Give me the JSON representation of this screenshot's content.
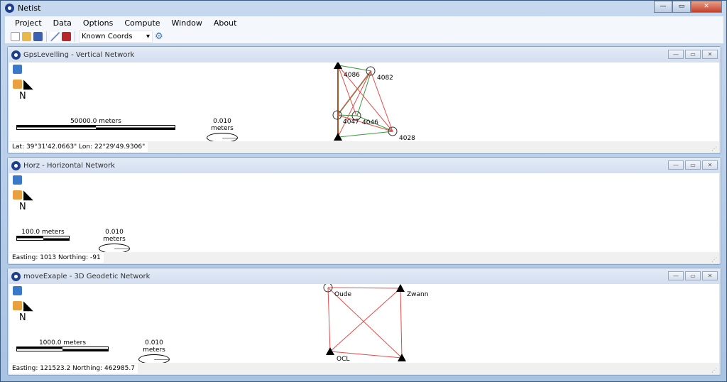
{
  "app": {
    "title": "Netist",
    "controls": [
      "minimize",
      "maximize",
      "close"
    ]
  },
  "menu": [
    "Project",
    "Data",
    "Options",
    "Compute",
    "Window",
    "About"
  ],
  "toolbar": {
    "icons": [
      "new-file-icon",
      "open-folder-icon",
      "save-icon",
      "draw-icon",
      "toolbox-icon"
    ],
    "combo_value": "Known Coords",
    "settings_icon": "gear-icon"
  },
  "windows": [
    {
      "title": "GpsLevelling - Vertical Network",
      "scale_label": "50000.0 meters",
      "ellipse_label": "0.010 meters",
      "status": "Lat: 39°31'42.0663\"  Lon: 22°29'49.9306\"",
      "stations": [
        {
          "name": "4086",
          "type": "fixed"
        },
        {
          "name": "4082",
          "type": "free"
        },
        {
          "name": "4047",
          "type": "free"
        },
        {
          "name": "4046",
          "type": "free"
        },
        {
          "name": "4028",
          "type": "free"
        },
        {
          "name": "",
          "type": "fixed"
        }
      ]
    },
    {
      "title": "Horz - Horizontal Network",
      "scale_label": "100.0 meters",
      "ellipse_label": "0.010 meters",
      "status": "Easting: 1013  Northing: -91",
      "stations": []
    },
    {
      "title": "moveExaple - 3D Geodetic Network",
      "scale_label": "1000.0 meters",
      "ellipse_label": "0.010 meters",
      "status": "Easting: 121523.2  Northing: 462985.7",
      "stations": [
        {
          "name": "Oude",
          "type": "free"
        },
        {
          "name": "Zwann",
          "type": "fixed"
        },
        {
          "name": "OCL",
          "type": "fixed"
        },
        {
          "name": "",
          "type": "fixed"
        }
      ]
    }
  ],
  "north_label": "N",
  "colors": {
    "observation_red": "#e84a4a",
    "observation_green": "#3a9a3a"
  }
}
